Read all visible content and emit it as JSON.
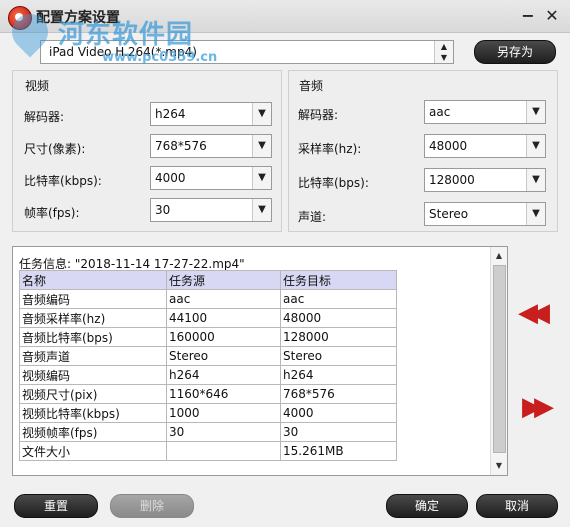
{
  "window": {
    "title": "配置方案设置",
    "minimize": "−",
    "close": "✕"
  },
  "watermark": {
    "site": "河东软件园",
    "url": "www.pc0359.cn"
  },
  "profile": {
    "value": "iPad Video H.264(*.mp4)",
    "save_as_label": "另存为"
  },
  "video": {
    "title": "视频",
    "encoder_label": "解码器:",
    "encoder_value": "h264",
    "size_label": "尺寸(像素):",
    "size_value": "768*576",
    "bitrate_label": "比特率(kbps):",
    "bitrate_value": "4000",
    "framerate_label": "帧率(fps):",
    "framerate_value": "30"
  },
  "audio": {
    "title": "音频",
    "encoder_label": "解码器:",
    "encoder_value": "aac",
    "samplerate_label": "采样率(hz):",
    "samplerate_value": "48000",
    "bitrate_label": "比特率(bps):",
    "bitrate_value": "128000",
    "channel_label": "声道:",
    "channel_value": "Stereo"
  },
  "task_info": {
    "info": "任务信息: \"2018-11-14 17-27-22.mp4\"",
    "headers": [
      "名称",
      "任务源",
      "任务目标"
    ],
    "rows": [
      [
        "音频编码",
        "aac",
        "aac"
      ],
      [
        "音频采样率(hz)",
        "44100",
        "48000"
      ],
      [
        "音频比特率(bps)",
        "160000",
        "128000"
      ],
      [
        "音频声道",
        "Stereo",
        "Stereo"
      ],
      [
        "视频编码",
        "h264",
        "h264"
      ],
      [
        "视频尺寸(pix)",
        "1160*646",
        "768*576"
      ],
      [
        "视频比特率(kbps)",
        "1000",
        "4000"
      ],
      [
        "视频帧率(fps)",
        "30",
        "30"
      ],
      [
        "文件大小",
        "",
        "15.261MB"
      ]
    ]
  },
  "nav": {
    "prev": "◀◀",
    "next": "▶▶"
  },
  "footer": {
    "reset": "重置",
    "delete": "删除",
    "ok": "确定",
    "cancel": "取消"
  },
  "icons": {
    "dropdown": "chevron-down-icon"
  }
}
